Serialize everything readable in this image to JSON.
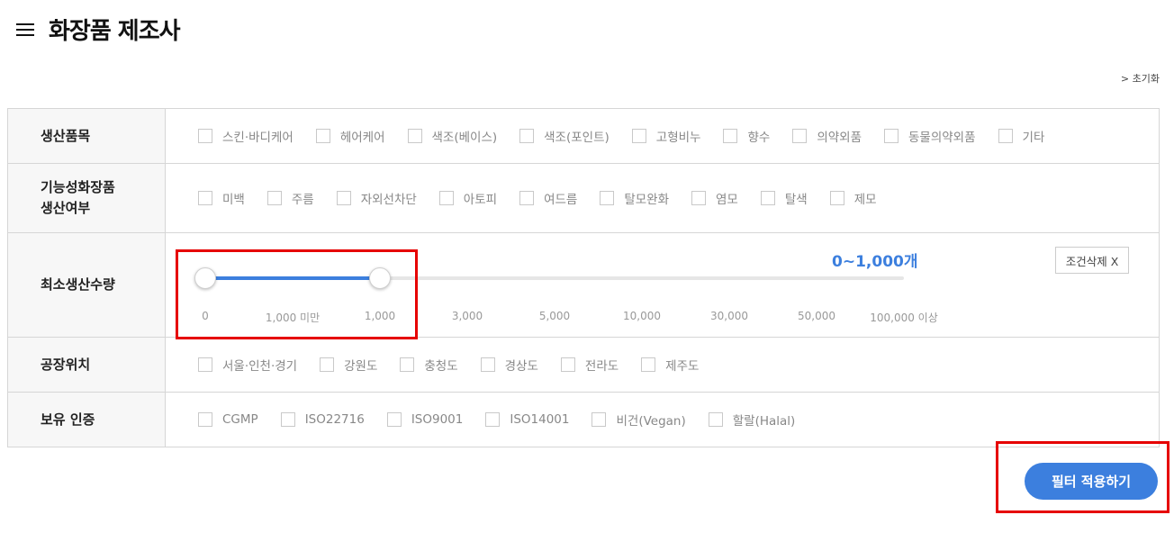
{
  "header": {
    "title": "화장품 제조사",
    "menu_icon": "hamburger-menu-icon"
  },
  "reset_link": "> 초기화",
  "filters": {
    "production_items": {
      "label": "생산품목",
      "options": [
        "스킨·바디케어",
        "헤어케어",
        "색조(베이스)",
        "색조(포인트)",
        "고형비누",
        "향수",
        "의약외품",
        "동물의약외품",
        "기타"
      ]
    },
    "functional": {
      "label_line1": "기능성화장품",
      "label_line2": "생산여부",
      "options": [
        "미백",
        "주름",
        "자외선차단",
        "아토피",
        "여드름",
        "탈모완화",
        "염모",
        "탈색",
        "제모"
      ]
    },
    "min_quantity": {
      "label": "최소생산수량",
      "range_text": "0~1,000개",
      "clear_label": "조건삭제 X",
      "ticks": [
        "0",
        "1,000 미만",
        "1,000",
        "3,000",
        "5,000",
        "10,000",
        "30,000",
        "50,000",
        "100,000 이상"
      ],
      "selected_start_index": 0,
      "selected_end_index": 2
    },
    "location": {
      "label": "공장위치",
      "options": [
        "서울·인천·경기",
        "강원도",
        "충청도",
        "경상도",
        "전라도",
        "제주도"
      ]
    },
    "certification": {
      "label": "보유 인증",
      "options": [
        "CGMP",
        "ISO22716",
        "ISO9001",
        "ISO14001",
        "비건(Vegan)",
        "할랄(Halal)"
      ]
    }
  },
  "apply_button": "필터 적용하기",
  "colors": {
    "accent": "#3c7fde",
    "highlight": "#e60000"
  }
}
